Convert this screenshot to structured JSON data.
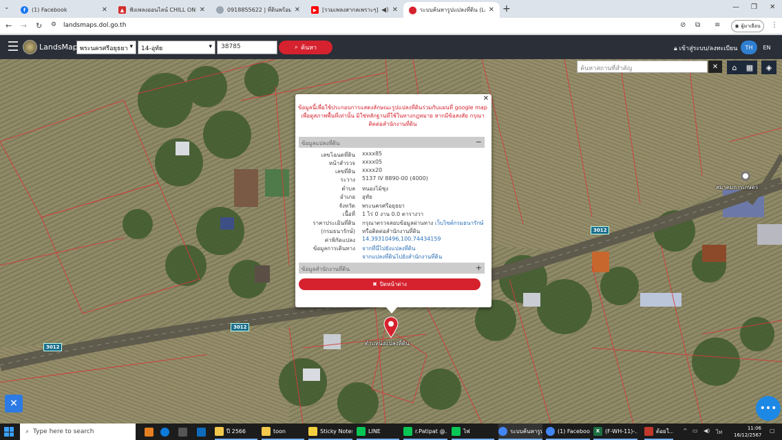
{
  "browser": {
    "tabs": [
      {
        "title": "(1) Facebook",
        "icon": "facebook-icon",
        "color": "#1877f2",
        "active": false
      },
      {
        "title": "ฟังเพลงออนไลน์ CHILL ONLINE - ฟ",
        "icon": "chill-online-icon",
        "color": "#d32f2f",
        "active": false
      },
      {
        "title": "0918855622 | ที่ดินพร้อมสิ่งปลูกสร้าง",
        "icon": "shield-icon",
        "color": "#9aa6b2",
        "active": false
      },
      {
        "title": "[รวมเพลงสากลเพราะๆ] Cover |",
        "icon": "youtube-icon",
        "color": "#ff0000",
        "active": false
      },
      {
        "title": "ระบบค้นหารูปแปลงที่ดิน (LandsMaps",
        "icon": "location-pin-icon",
        "color": "#d6222e",
        "active": true
      }
    ],
    "url": "landsmaps.dol.go.th",
    "profile_label": "ผู้มาเยือน"
  },
  "header": {
    "logo_text": "LandsMaps",
    "province": "พระนครศรีอยุธยา",
    "district": "14-อุทัย",
    "parcel_number": "38785",
    "search_label": "ค้นหา",
    "login_label": "เข้าสู่ระบบ/ลงทะเบียน",
    "lang_th": "TH",
    "lang_en": "EN"
  },
  "map": {
    "place_search_placeholder": "ค้นหาสถานที่สำคัญ",
    "road_sign": "3012",
    "landmark_label": "สมาคมการเกษตร",
    "marker_label": "ตำแหน่งแปลงที่ดิน"
  },
  "popup": {
    "disclaimer": "ข้อมูลนี้เพื่อใช้ประกอบการแสดงลักษณะรูปแปลงที่ดินร่วมกับแผนที่ google map เพื่อดูสภาพพื้นที่เท่านั้น มิใช่หลักฐานที่ใช้ในทางกฎหมาย หากมีข้อสงสัย กรุณาติดต่อสำนักงานที่ดิน",
    "section_parcel": "ข้อมูลแปลงที่ดิน",
    "section_office": "ข้อมูลสำนักงานที่ดิน",
    "rows": [
      {
        "key": "เลขโฉนดที่ดิน",
        "value": "xxxx85"
      },
      {
        "key": "หน้าสำรวจ",
        "value": "xxxx05"
      },
      {
        "key": "เลขที่ดิน",
        "value": "xxxx20"
      },
      {
        "key": "ระวาง",
        "value": "5137 IV 8890-00 (4000)"
      },
      {
        "key": "ตำบล",
        "value": "หนองไม้ซุง"
      },
      {
        "key": "อำเภอ",
        "value": "อุทัย"
      },
      {
        "key": "จังหวัด",
        "value": "พระนครศรีอยุธยา"
      },
      {
        "key": "เนื้อที่",
        "value": "1 ไร่ 0 งาน 0.0 ตารางวา"
      }
    ],
    "price_key": "ราคาประเมินที่ดิน",
    "price_key2": "(กรมธนารักษ์)",
    "price_text": "กรุณาตรวจสอบข้อมูลผ่านทาง",
    "price_link": "เว็บไซต์กรมธนารักษ์",
    "price_text2": "หรือติดต่อสำนักงานที่ดิน",
    "coord_key": "ค่าพิกัดแปลง",
    "coord_value": "14.39310496,100.74434159",
    "travel_key": "ข้อมูลการเดินทาง",
    "travel_link1": "จากที่นี่ไปยังแปลงที่ดิน",
    "travel_link2": "จากแปลงที่ดินไปยังสำนักงานที่ดิน",
    "close_label": "ปิดหน้าต่าง"
  },
  "taskbar": {
    "search_placeholder": "Type here to search",
    "apps": [
      {
        "label": "ปี 2566",
        "icon": "folder-icon",
        "color": "#f2c94c"
      },
      {
        "label": "toon",
        "icon": "folder-icon",
        "color": "#f2c94c"
      },
      {
        "label": "Sticky Notes",
        "icon": "sticky-notes-icon",
        "color": "#f4d03f"
      },
      {
        "label": "LINE",
        "icon": "line-icon",
        "color": "#06c755"
      },
      {
        "label": "r.Patipat @...",
        "icon": "line-icon",
        "color": "#06c755"
      },
      {
        "label": "ไฟ",
        "icon": "line-icon",
        "color": "#06c755"
      },
      {
        "label": "ระบบค้นหารูป...",
        "icon": "chrome-icon",
        "color": "#4285f4"
      },
      {
        "label": "(1) Faceboo...",
        "icon": "chrome-icon",
        "color": "#4285f4"
      },
      {
        "label": "(F-WH-11)-...",
        "icon": "excel-icon",
        "color": "#1d6f42"
      },
      {
        "label": "ต้อยใ...",
        "icon": "app-icon",
        "color": "#c0392b"
      }
    ],
    "time": "11:06",
    "date": "16/12/2567"
  }
}
